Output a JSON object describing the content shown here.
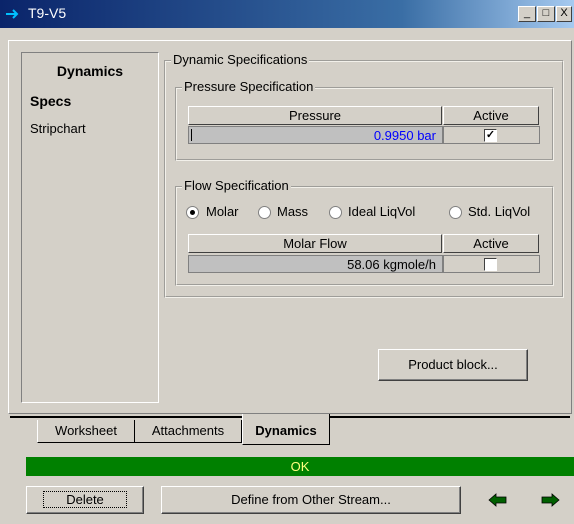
{
  "window": {
    "title": "T9-V5",
    "minimize": "_",
    "restore": "□",
    "close": "X"
  },
  "nav": {
    "heading": "Dynamics",
    "items": [
      {
        "label": "Specs",
        "selected": true
      },
      {
        "label": "Stripchart",
        "selected": false
      }
    ]
  },
  "dynamic_specs": {
    "group_label": "Dynamic Specifications",
    "pressure": {
      "group_label": "Pressure Specification",
      "col_value": "Pressure",
      "col_active": "Active",
      "value": "0.9950 bar",
      "active": true,
      "check_mark": "✓"
    },
    "flow": {
      "group_label": "Flow Specification",
      "basis_options": [
        "Molar",
        "Mass",
        "Ideal LiqVol",
        "Std. LiqVol"
      ],
      "selected_basis": "Molar",
      "col_value": "Molar Flow",
      "col_active": "Active",
      "value": "58.06 kgmole/h",
      "active": false
    }
  },
  "product_block_button": "Product block...",
  "tabs": [
    {
      "label": "Worksheet",
      "active": false
    },
    {
      "label": "Attachments",
      "active": false
    },
    {
      "label": "Dynamics",
      "active": true
    }
  ],
  "status": {
    "text": "OK",
    "color": "#008000"
  },
  "footer": {
    "delete_button": "Delete",
    "define_button": "Define from Other Stream...",
    "prev_icon": "arrow-left-icon",
    "next_icon": "arrow-right-icon"
  },
  "colors": {
    "accent_text": "#0000ff",
    "title_bar": "#0a246a",
    "arrow_green": "#006000"
  }
}
